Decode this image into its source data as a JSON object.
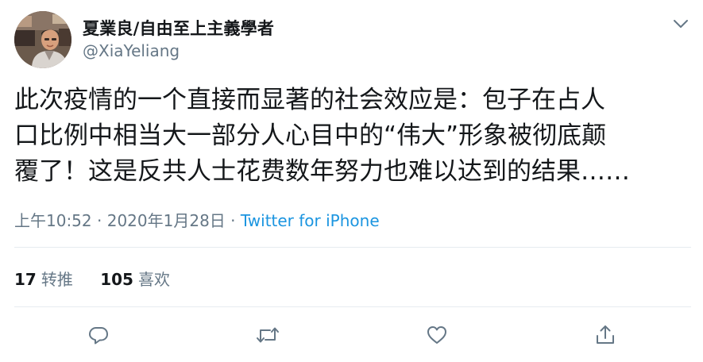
{
  "user": {
    "display_name": "夏業良/自由至上主義學者",
    "handle": "@XiaYeliang"
  },
  "tweet": {
    "text_lines": [
      "此次疫情的一个直接而显著的社会效应是：包子在占人",
      "口比例中相当大一部分人心目中的“伟大”形象被彻底颠",
      "覆了！这是反共人士花费数年努力也难以达到的结果……"
    ],
    "time": "上午10:52",
    "separator": "·",
    "date": "2020年1月28日",
    "source": "Twitter for iPhone"
  },
  "stats": {
    "retweets_count": "17",
    "retweets_label": "转推",
    "likes_count": "105",
    "likes_label": "喜欢"
  },
  "icons": {
    "menu": "chevron-down-icon",
    "reply": "reply-icon",
    "retweet": "retweet-icon",
    "like": "heart-icon",
    "share": "share-icon"
  },
  "colors": {
    "text": "#14171a",
    "secondary": "#657786",
    "link": "#1b95e0",
    "divider": "#e6ecf0"
  }
}
